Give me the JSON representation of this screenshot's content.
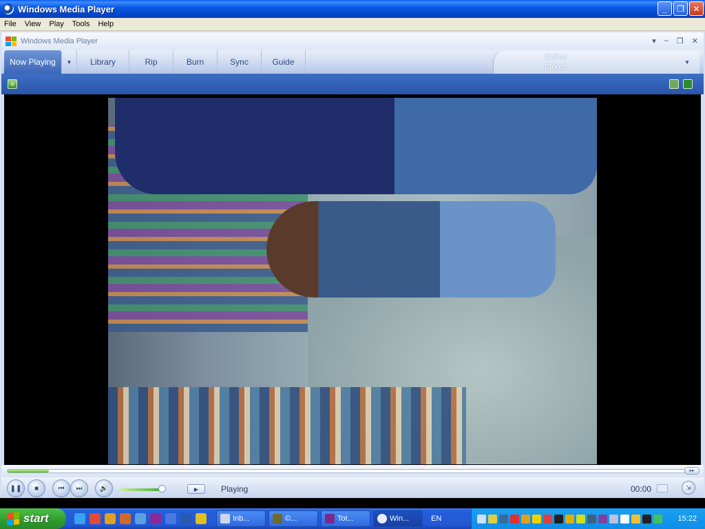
{
  "window": {
    "title": "Windows Media Player",
    "controls": [
      "_",
      "❐",
      "✕"
    ]
  },
  "menu": [
    "File",
    "View",
    "Play",
    "Tools",
    "Help"
  ],
  "wmp": {
    "title": "Windows Media Player",
    "title_controls": [
      "▾",
      "–",
      "❐",
      "✕"
    ],
    "tabs": [
      {
        "label": "Now Playing",
        "active": true
      },
      {
        "label": "Library"
      },
      {
        "label": "Rip"
      },
      {
        "label": "Burn"
      },
      {
        "label": "Sync"
      },
      {
        "label": "Guide"
      }
    ],
    "tab_dropdown": "▼",
    "stores": {
      "line1": "Online",
      "line2": "Stores",
      "caret": "▼"
    }
  },
  "playback": {
    "status": "Playing",
    "time": "00:00",
    "seek_progress": 0.06,
    "volume_level": 0.92,
    "icons": {
      "pause": "pause-icon",
      "stop": "stop-icon",
      "previous": "previous-icon",
      "next": "next-icon",
      "mute": "speaker-icon",
      "play": "play-icon",
      "mini": "mini-mode-icon"
    }
  },
  "taskbar": {
    "start_label": "start",
    "tasks": [
      {
        "label": "Inb...",
        "color": "#cfd8e8"
      },
      {
        "label": "©...",
        "color": "#6b6b2b"
      },
      {
        "label": "Tot...",
        "color": "#7a2a8a"
      },
      {
        "label": "Win...",
        "color": "#e8eef9",
        "active": true
      }
    ],
    "language": "EN",
    "clock": "15:22"
  },
  "colors": {
    "titlebar": "#0a5ae6",
    "wmp_accent": "#3a66b8",
    "seek_fill": "#55b82a",
    "taskbar": "#2358d4",
    "start_button": "#2d9a2b"
  }
}
